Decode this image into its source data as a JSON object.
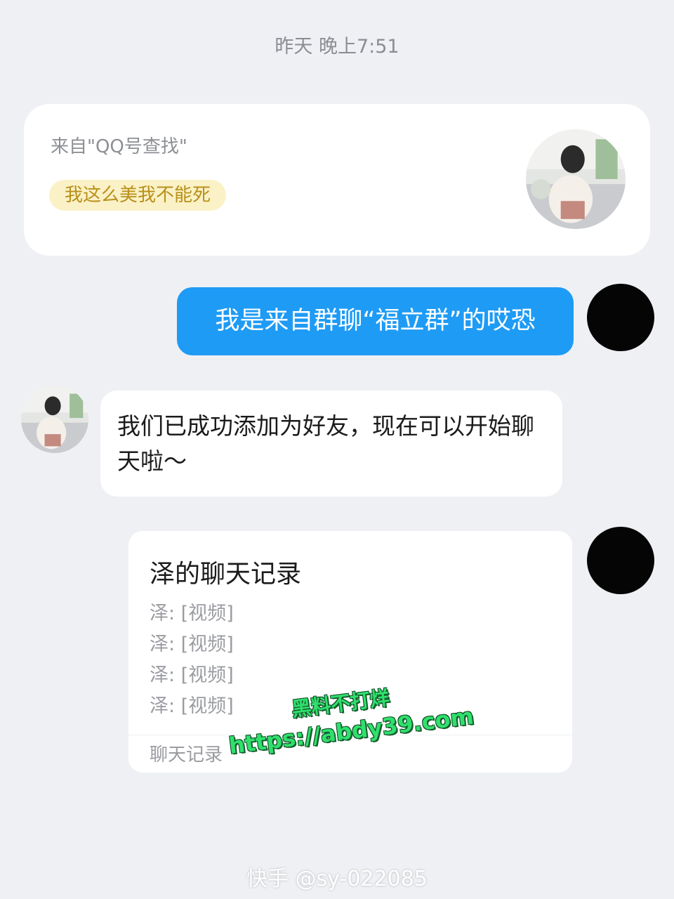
{
  "chat": {
    "timestamp": "昨天 晚上7:51",
    "profile_card": {
      "source": "来自\"QQ号查找\"",
      "tag": "我这么美我不能死"
    },
    "messages": [
      {
        "direction": "outgoing",
        "text": "我是来自群聊“福立群”的哎恐"
      },
      {
        "direction": "incoming",
        "text": "我们已成功添加为好友，现在可以开始聊天啦～"
      }
    ],
    "history_card": {
      "title": "泽的聊天记录",
      "lines": [
        "泽: [视频]",
        "泽: [视频]",
        "泽: [视频]",
        "泽: [视频]"
      ],
      "footer": "聊天记录"
    }
  },
  "overlay": {
    "watermark_line1": "黑料不打烊",
    "watermark_line2": "https://abdy39.com",
    "platform_mark": "快手 @sy-022085"
  },
  "colors": {
    "background": "#eff0f4",
    "outgoing_bubble": "#1e9bf5",
    "tag_background": "#fbf1c6",
    "tag_text": "#b8901a",
    "watermark_green": "#2fe06d"
  }
}
